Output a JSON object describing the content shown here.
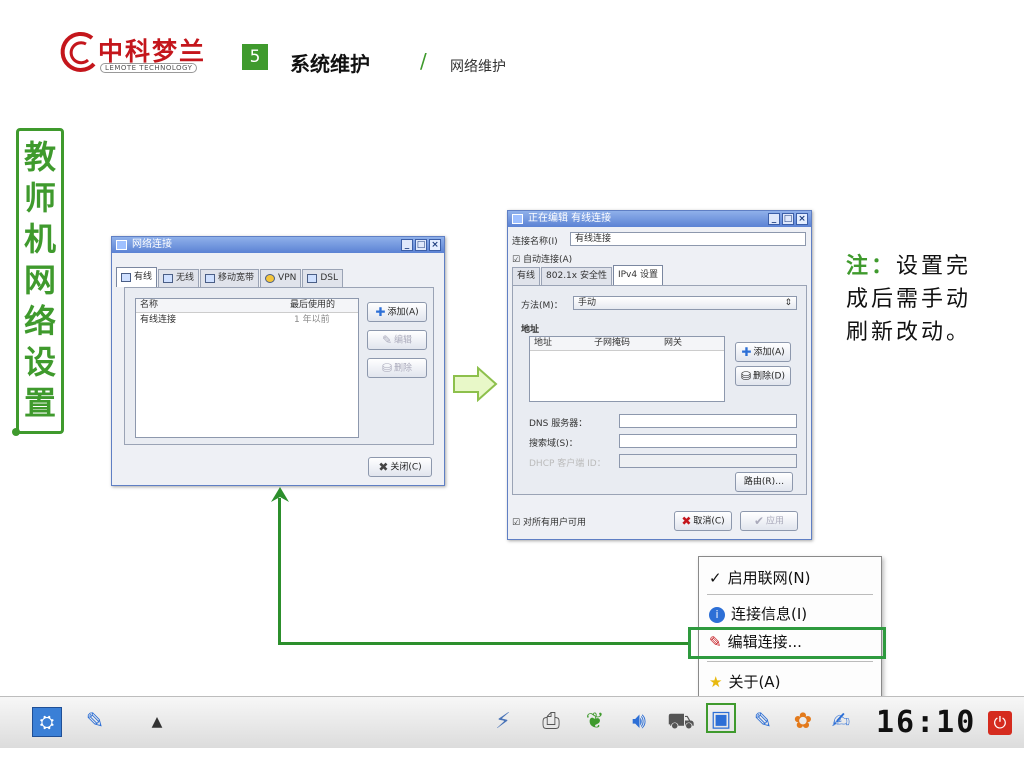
{
  "header": {
    "logo_cn": "中科梦兰",
    "logo_en": "LEMOTE TECHNOLOGY",
    "section_number": "5",
    "section_title": "系统维护",
    "separator": "/",
    "section_sub": "网络维护"
  },
  "vertical_title": "教师机网络设置",
  "note": {
    "label": "注：",
    "text": "设置完成后需手动刷新改动。"
  },
  "network_window": {
    "title": "网络连接",
    "tabs": [
      "有线",
      "无线",
      "移动宽带",
      "VPN",
      "DSL"
    ],
    "columns": [
      "名称",
      "最后使用的"
    ],
    "rows": [
      {
        "name": "有线连接",
        "last_used": "1 年以前"
      }
    ],
    "buttons": {
      "add": "添加(A)",
      "edit": "编辑",
      "delete": "删除",
      "close": "关闭(C)"
    }
  },
  "edit_window": {
    "title": "正在编辑 有线连接",
    "conn_name_label": "连接名称(I)",
    "conn_name_value": "有线连接",
    "auto_connect": "自动连接(A)",
    "tabs": [
      "有线",
      "802.1x 安全性",
      "IPv4 设置"
    ],
    "method_label": "方法(M)：",
    "method_value": "手动",
    "address_section": "地址",
    "address_columns": [
      "地址",
      "子网掩码",
      "网关"
    ],
    "add_button": "添加(A)",
    "delete_button": "删除(D)",
    "dns_label": "DNS 服务器：",
    "search_label": "搜索域(S)：",
    "dhcp_label": "DHCP 客户端 ID：",
    "routes_button": "路由(R)…",
    "all_users": "对所有用户可用",
    "cancel_button": "取消(C)",
    "apply_button": "应用"
  },
  "tray_menu": {
    "items": [
      "启用联网(N)",
      "连接信息(I)",
      "编辑连接...",
      "关于(A)"
    ]
  },
  "taskbar": {
    "clock": "16:10"
  },
  "colors": {
    "accent_green": "#3f9a2d",
    "logo_red": "#c4161c",
    "window_blue": "#5b82d4"
  }
}
